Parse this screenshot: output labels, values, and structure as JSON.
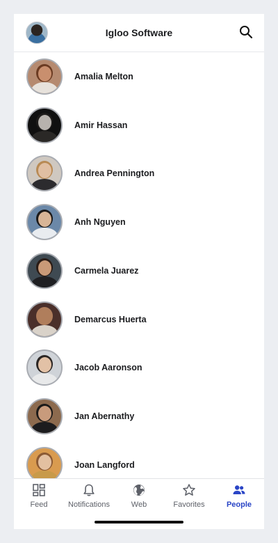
{
  "header": {
    "title": "Igloo Software",
    "avatar_icon": "user-avatar",
    "search_icon": "search-icon"
  },
  "people": [
    {
      "name": "Amalia Melton",
      "skin": "#c98f6e",
      "hair": "#6b3b22",
      "shirt": "#e7e2dc",
      "bg": "#b58a70"
    },
    {
      "name": "Amir Hassan",
      "skin": "#b7b2ad",
      "hair": "#1d1b1a",
      "shirt": "#2a2826",
      "bg": "#101010"
    },
    {
      "name": "Andrea Pennington",
      "skin": "#e0bfa3",
      "hair": "#b88a54",
      "shirt": "#2c2b2e",
      "bg": "#cfc8c0"
    },
    {
      "name": "Anh Nguyen",
      "skin": "#d8b597",
      "hair": "#1c1a1a",
      "shirt": "#e9ecf0",
      "bg": "#6b88a8"
    },
    {
      "name": "Carmela Juarez",
      "skin": "#c99a78",
      "hair": "#2a1c16",
      "shirt": "#1f1f22",
      "bg": "#3f4a52"
    },
    {
      "name": "Demarcus Huerta",
      "skin": "#b07e5c",
      "hair": "#b07e5c",
      "shirt": "#d9d2c9",
      "bg": "#4a2f2a"
    },
    {
      "name": "Jacob Aaronson",
      "skin": "#e2c1a6",
      "hair": "#2b2624",
      "shirt": "#e8e9ea",
      "bg": "#cfd3d8"
    },
    {
      "name": "Jan Abernathy",
      "skin": "#c89b7c",
      "hair": "#1b1a19",
      "shirt": "#1c1c1e",
      "bg": "#8c6a4e"
    },
    {
      "name": "Joan Langford",
      "skin": "#e3c0a1",
      "hair": "#8b5a34",
      "shirt": "#c89a4a",
      "bg": "#d99b4f"
    }
  ],
  "tabs": [
    {
      "id": "feed",
      "label": "Feed",
      "icon": "grid-icon",
      "active": false
    },
    {
      "id": "notifications",
      "label": "Notifications",
      "icon": "bell-icon",
      "active": false
    },
    {
      "id": "web",
      "label": "Web",
      "icon": "globe-icon",
      "active": false
    },
    {
      "id": "favorites",
      "label": "Favorites",
      "icon": "star-icon",
      "active": false
    },
    {
      "id": "people",
      "label": "People",
      "icon": "people-icon",
      "active": true
    }
  ],
  "colors": {
    "accent": "#2a45c6",
    "inactive_tab": "#5d6068",
    "text": "#1b1c1f"
  }
}
